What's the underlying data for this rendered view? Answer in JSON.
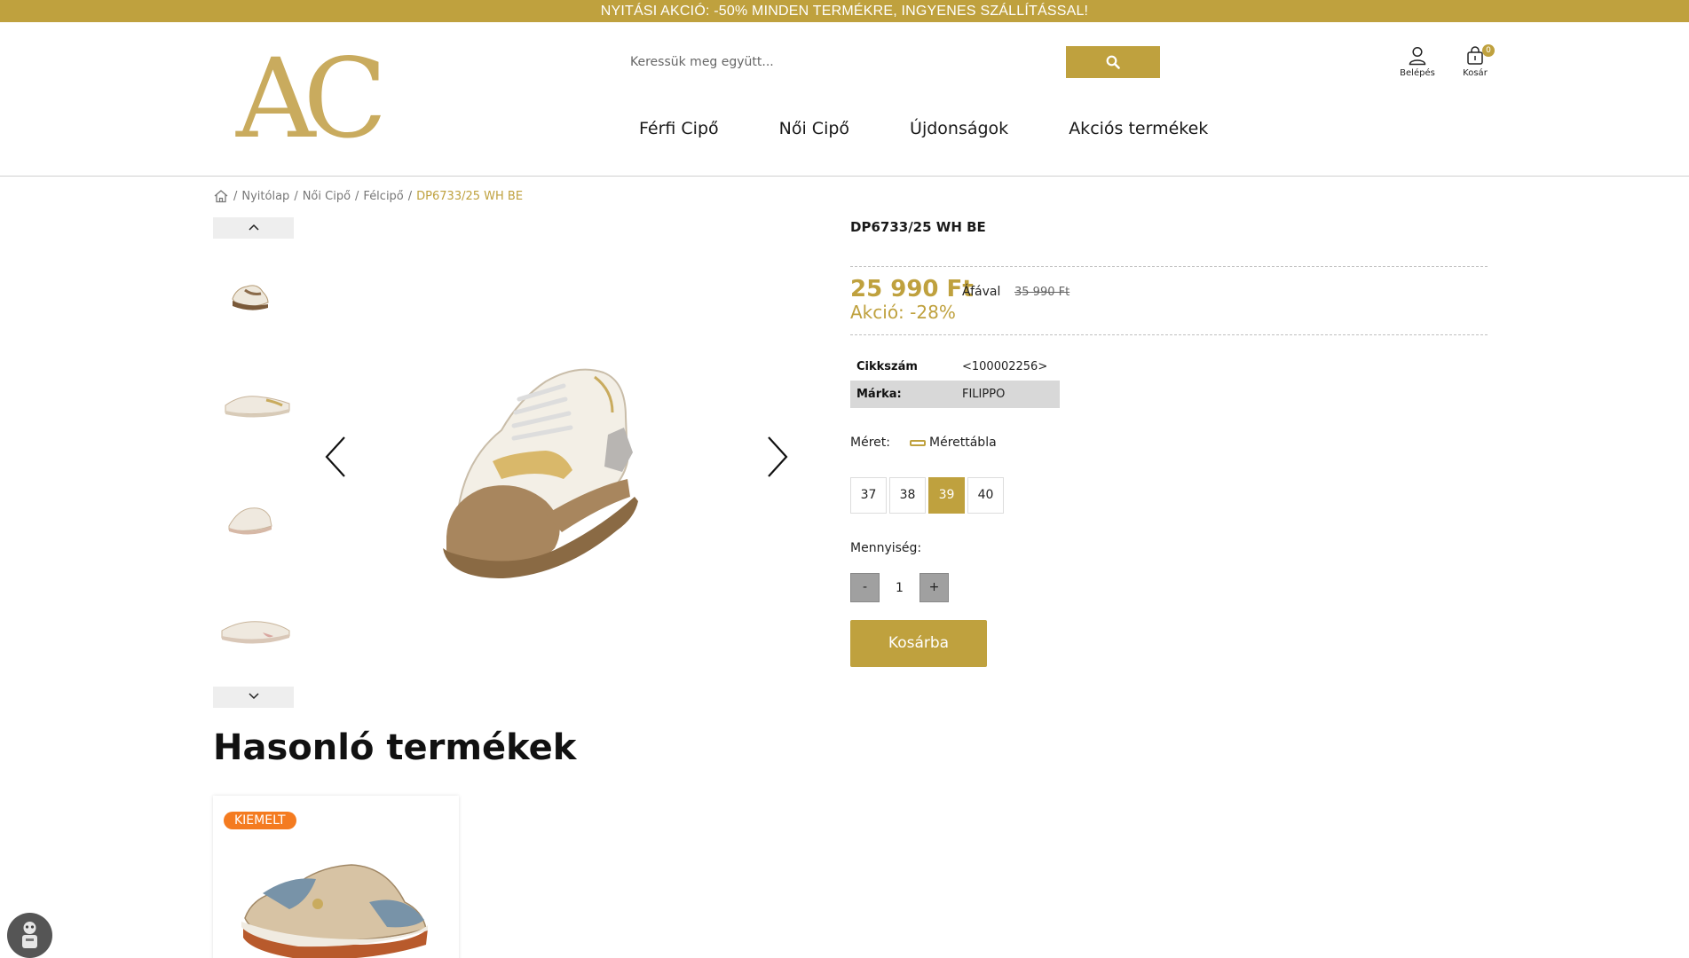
{
  "promo_bar": {
    "text": "NYITÁSI AKCIÓ: -50% MINDEN TERMÉKRE, INGYENES SZÁLLÍTÁSSAL!"
  },
  "header": {
    "logo_text": "AC",
    "search": {
      "placeholder": "Keressük meg együtt...",
      "icon": "search-icon"
    },
    "account": {
      "label": "Belépés",
      "icon": "user-icon"
    },
    "cart": {
      "label": "Kosár",
      "count": "0",
      "icon": "shopping-bag-icon"
    },
    "nav": [
      {
        "label": "Férfi Cipő"
      },
      {
        "label": "Női Cipő"
      },
      {
        "label": "Újdonságok"
      },
      {
        "label": "Akciós termékek"
      }
    ]
  },
  "breadcrumb": {
    "home_icon": "home-icon",
    "items": [
      "Nyitólap",
      "Női Cipő",
      "Félcipő"
    ],
    "current": "DP6733/25 WH BE"
  },
  "product": {
    "title": "DP6733/25 WH BE",
    "price": "25 990 Ft",
    "vat_label": "Áfával",
    "old_price": "35 990 Ft",
    "sale_label": "Akció: -28%",
    "specs": [
      {
        "key": "Cikkszám",
        "value": "<100002256>"
      },
      {
        "key": "Márka:",
        "value": "FILIPPO"
      }
    ],
    "size_label": "Méret:",
    "size_chart_label": "Mérettábla",
    "sizes": [
      "37",
      "38",
      "39",
      "40"
    ],
    "selected_size": "39",
    "quantity_label": "Mennyiség:",
    "quantity": "1",
    "minus_label": "-",
    "plus_label": "+",
    "add_to_cart_label": "Kosárba"
  },
  "similar": {
    "title": "Hasonló termékek",
    "cards": [
      {
        "badge": "KIEMELT"
      }
    ]
  },
  "colors": {
    "accent": "#bfa13e",
    "badge": "#f47b20"
  }
}
